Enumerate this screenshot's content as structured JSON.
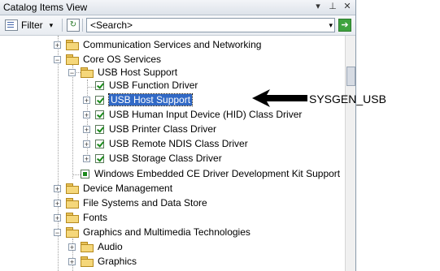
{
  "window": {
    "title": "Catalog Items View",
    "controls": [
      "▾",
      "⊥",
      "✕"
    ]
  },
  "toolbar": {
    "filter_label": "Filter",
    "filter_arrow": "▾",
    "refresh_icon": "↻",
    "search_value": "<Search>",
    "search_arrow": "▾",
    "go_icon": "➔"
  },
  "tree": {
    "items": [
      {
        "label": "Communication Services and Networking",
        "kind": "folder",
        "expander": "+"
      },
      {
        "label": "Core OS Services",
        "kind": "folder",
        "expander": "−"
      },
      {
        "label": "USB Host Support",
        "kind": "folder",
        "expander": "−"
      },
      {
        "label": "USB Function Driver",
        "kind": "check",
        "expander": ""
      },
      {
        "label": "USB Host Support",
        "kind": "check",
        "expander": "+",
        "selected": true
      },
      {
        "label": "USB Human Input Device (HID) Class Driver",
        "kind": "check",
        "expander": "+"
      },
      {
        "label": "USB Printer Class Driver",
        "kind": "check",
        "expander": "+"
      },
      {
        "label": "USB Remote NDIS Class Driver",
        "kind": "check",
        "expander": "+"
      },
      {
        "label": "USB Storage Class Driver",
        "kind": "check",
        "expander": "+"
      },
      {
        "label": "Windows Embedded CE Driver Development Kit Support",
        "kind": "square",
        "expander": ""
      },
      {
        "label": "Device Management",
        "kind": "folder",
        "expander": "+"
      },
      {
        "label": "File Systems and Data Store",
        "kind": "folder",
        "expander": "+"
      },
      {
        "label": "Fonts",
        "kind": "folder",
        "expander": "+"
      },
      {
        "label": "Graphics and Multimedia Technologies",
        "kind": "folder",
        "expander": "−"
      },
      {
        "label": "Audio",
        "kind": "folder",
        "expander": "+"
      },
      {
        "label": "Graphics",
        "kind": "folder",
        "expander": "+"
      }
    ]
  },
  "annotation": {
    "label": "SYSGEN_USB"
  }
}
